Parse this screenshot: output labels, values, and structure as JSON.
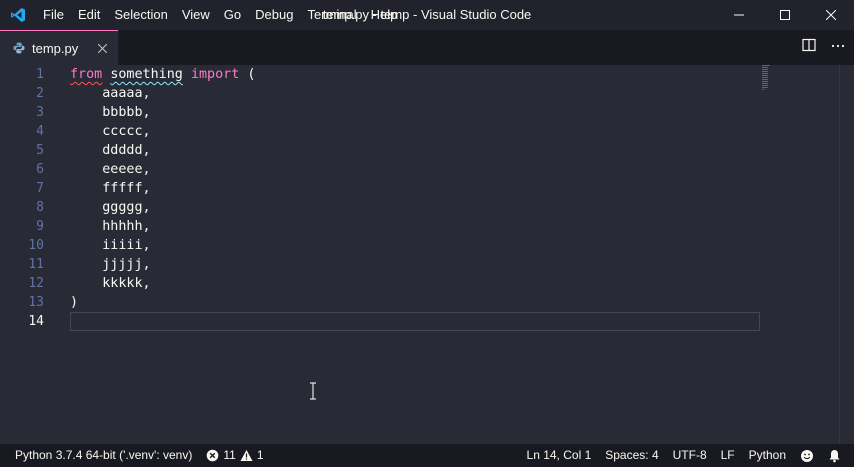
{
  "titlebar": {
    "menu": [
      "File",
      "Edit",
      "Selection",
      "View",
      "Go",
      "Debug",
      "Terminal",
      "Help"
    ],
    "window_title": "temp.py - temp - Visual Studio Code"
  },
  "tab": {
    "label": "temp.py",
    "icon": "python-icon"
  },
  "editor": {
    "line_numbers": [
      "1",
      "2",
      "3",
      "4",
      "5",
      "6",
      "7",
      "8",
      "9",
      "10",
      "11",
      "12",
      "13",
      "14"
    ],
    "active_line": 14,
    "code": {
      "line1": {
        "kw1": "from",
        "sp1": " ",
        "module": "something",
        "sp2": " ",
        "kw2": "import",
        "rest": " ("
      },
      "lines": [
        "    aaaaa,",
        "    bbbbb,",
        "    ccccc,",
        "    ddddd,",
        "    eeeee,",
        "    fffff,",
        "    ggggg,",
        "    hhhhh,",
        "    iiiii,",
        "    jjjjj,",
        "    kkkkk,",
        ")",
        ""
      ]
    }
  },
  "statusbar": {
    "interpreter": "Python 3.7.4 64-bit ('.venv': venv)",
    "errors": "11",
    "warnings": "1",
    "position": "Ln 14, Col 1",
    "spaces": "Spaces: 4",
    "encoding": "UTF-8",
    "eol": "LF",
    "language": "Python"
  },
  "colors": {
    "accent": "#ff79c6",
    "background": "#282a36",
    "bar": "#21222c"
  }
}
